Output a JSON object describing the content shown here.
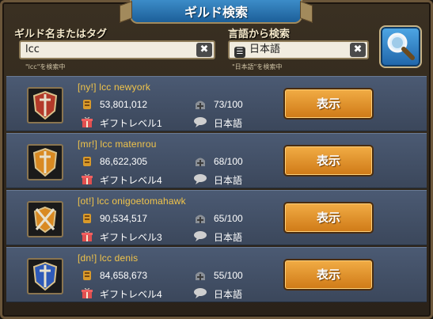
{
  "title": "ギルド検索",
  "search": {
    "name_label": "ギルド名またはタグ",
    "name_value": "lcc",
    "name_hint": "\"lcc\"を検索中",
    "lang_label": "言語から検索",
    "lang_value": "日本語",
    "lang_hint": "\"日本語\"を検索中",
    "clear_symbol": "✖"
  },
  "guilds": [
    {
      "name": "[ny!]  lcc newyork",
      "power": "53,801,012",
      "members": "73/100",
      "gift": "ギフトレベル1",
      "language": "日本語",
      "view_label": "表示",
      "emblem_color": "#b33a2a"
    },
    {
      "name": "[mr!]  lcc matenrou",
      "power": "86,622,305",
      "members": "68/100",
      "gift": "ギフトレベル4",
      "language": "日本語",
      "view_label": "表示",
      "emblem_color": "#d98a22"
    },
    {
      "name": "[ot!]  lcc onigoetomahawk",
      "power": "90,534,517",
      "members": "65/100",
      "gift": "ギフトレベル3",
      "language": "日本語",
      "view_label": "表示",
      "emblem_color": "#d98a22"
    },
    {
      "name": "[dn!]  lcc denis",
      "power": "84,658,673",
      "members": "55/100",
      "gift": "ギフトレベル4",
      "language": "日本語",
      "view_label": "表示",
      "emblem_color": "#2e5ab8"
    }
  ],
  "colors": {
    "accent": "#f1c44a",
    "button": "#e59a30",
    "title": "#2a78b8"
  }
}
